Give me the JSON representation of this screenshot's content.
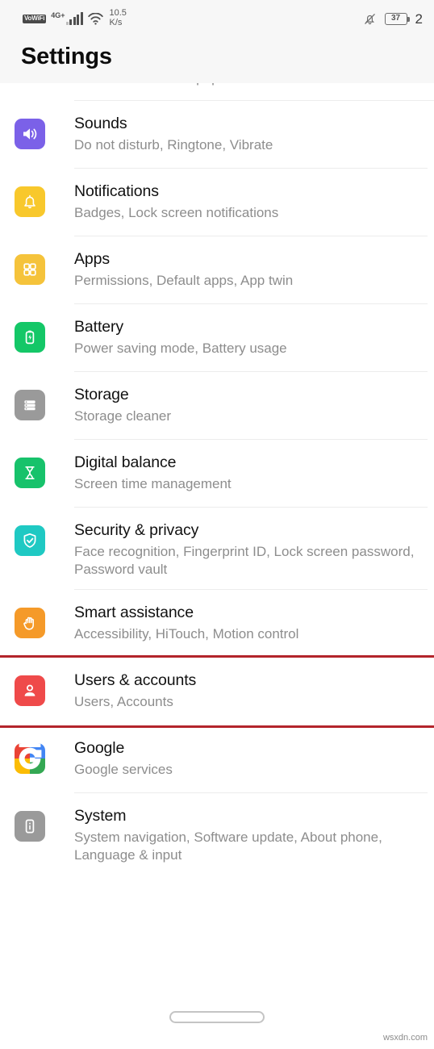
{
  "statusbar": {
    "volte_label": "VoWiFi",
    "network_label": "4G+",
    "speed_value": "10.5",
    "speed_unit": "K/s",
    "battery_level": "37",
    "clock_partial": "2",
    "icons": [
      "vowifi-badge",
      "signal-bars-icon",
      "wifi-icon",
      "bell-muted-icon",
      "battery-icon"
    ]
  },
  "header": {
    "title": "Settings"
  },
  "cut_row": {
    "fragment": "Home screen & wallpaper"
  },
  "colors": {
    "sounds": "#7B61E8",
    "notifications": "#F8C82C",
    "apps": "#F5C33B",
    "battery": "#14C767",
    "storage": "#9A9A9A",
    "digital_balance": "#17C26B",
    "security": "#1FC9C3",
    "smart_assistance": "#F59A29",
    "users_accounts": "#EF4A4A",
    "system": "#9A9A9A",
    "highlight_border": "#B3242B",
    "google_red": "#EA4335",
    "google_blue": "#4285F4",
    "google_yellow": "#FBBC05",
    "google_green": "#34A853"
  },
  "items": [
    {
      "id": "sounds",
      "title": "Sounds",
      "subtitle": "Do not disturb, Ringtone, Vibrate",
      "icon": "speaker-volume-icon",
      "highlighted": false
    },
    {
      "id": "notifications",
      "title": "Notifications",
      "subtitle": "Badges, Lock screen notifications",
      "icon": "bell-icon",
      "highlighted": false
    },
    {
      "id": "apps",
      "title": "Apps",
      "subtitle": "Permissions, Default apps, App twin",
      "icon": "grid-squares-icon",
      "highlighted": false
    },
    {
      "id": "battery",
      "title": "Battery",
      "subtitle": "Power saving mode, Battery usage",
      "icon": "battery-bolt-icon",
      "highlighted": false
    },
    {
      "id": "storage",
      "title": "Storage",
      "subtitle": "Storage cleaner",
      "icon": "storage-stack-icon",
      "highlighted": false
    },
    {
      "id": "digital-balance",
      "title": "Digital balance",
      "subtitle": "Screen time management",
      "icon": "hourglass-icon",
      "highlighted": false
    },
    {
      "id": "security-privacy",
      "title": "Security & privacy",
      "subtitle": "Face recognition, Fingerprint ID, Lock screen password, Password vault",
      "icon": "shield-check-icon",
      "highlighted": false
    },
    {
      "id": "smart-assistance",
      "title": "Smart assistance",
      "subtitle": "Accessibility, HiTouch, Motion control",
      "icon": "hand-icon",
      "highlighted": false
    },
    {
      "id": "users-accounts",
      "title": "Users & accounts",
      "subtitle": "Users, Accounts",
      "icon": "person-icon",
      "highlighted": true
    },
    {
      "id": "google",
      "title": "Google",
      "subtitle": "Google services",
      "icon": "google-g-icon",
      "highlighted": false
    },
    {
      "id": "system",
      "title": "System",
      "subtitle": "System navigation, Software update, About phone, Language & input",
      "icon": "phone-info-icon",
      "highlighted": false
    }
  ],
  "navigation": {
    "gesture_bar": "home-gesture-bar"
  },
  "watermark": {
    "text": "wsxdn.com"
  }
}
